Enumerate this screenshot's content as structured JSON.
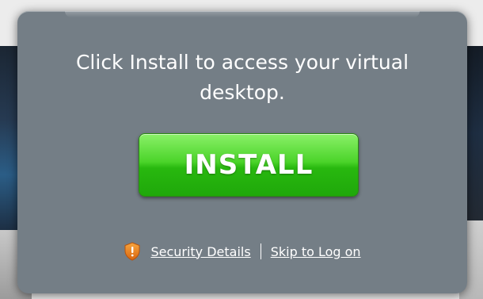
{
  "dialog": {
    "message": "Click Install to access your virtual desktop.",
    "install_label": "INSTALL",
    "links": {
      "security_icon": "shield-warning-icon",
      "security_label": "Security Details",
      "skip_label": "Skip to Log on"
    }
  },
  "colors": {
    "dialog_bg": "#747e86",
    "install_green": "#3cc81e",
    "shield_orange": "#e8801c"
  }
}
